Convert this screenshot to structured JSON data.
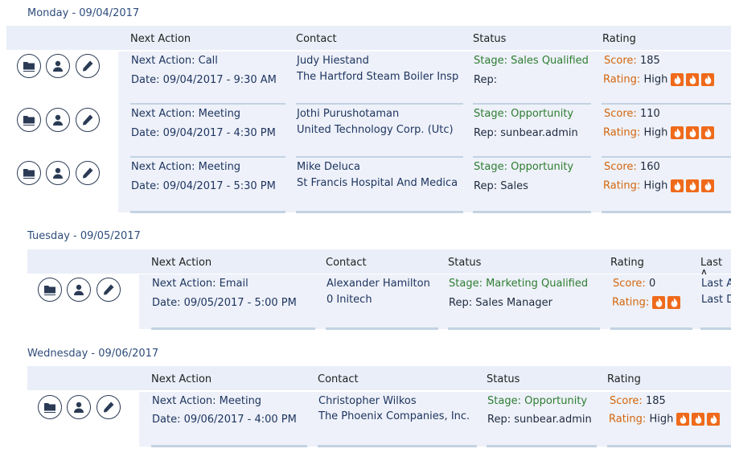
{
  "headers": {
    "next_action": "Next Action",
    "contact": "Contact",
    "status": "Status",
    "rating": "Rating",
    "last": "Last A"
  },
  "days": [
    {
      "title": "Monday - 09/04/2017",
      "rows": [
        {
          "next_action": "Next Action: Call",
          "date": "Date: 09/04/2017 - 9:30 AM",
          "contact_name": "Judy Hiestand",
          "company": "The Hartford Steam Boiler Insp",
          "stage_label": "Stage:",
          "stage": "Sales Qualified",
          "rep_label": "Rep:",
          "rep": "",
          "score_label": "Score:",
          "score": "185",
          "rating_label": "Rating:",
          "rating": "High",
          "flames": 3
        },
        {
          "next_action": "Next Action: Meeting",
          "date": "Date: 09/04/2017 - 4:30 PM",
          "contact_name": "Jothi Purushotaman",
          "company": "United Technology Corp. (Utc)",
          "stage_label": "Stage:",
          "stage": "Opportunity",
          "rep_label": "Rep:",
          "rep": "sunbear.admin",
          "score_label": "Score:",
          "score": "110",
          "rating_label": "Rating:",
          "rating": "High",
          "flames": 3
        },
        {
          "next_action": "Next Action: Meeting",
          "date": "Date: 09/04/2017 - 5:30 PM",
          "contact_name": "Mike Deluca",
          "company": "St Francis Hospital And Medica",
          "stage_label": "Stage:",
          "stage": "Opportunity",
          "rep_label": "Rep:",
          "rep": "Sales",
          "score_label": "Score:",
          "score": "160",
          "rating_label": "Rating:",
          "rating": "High",
          "flames": 3
        }
      ]
    },
    {
      "title": "Tuesday - 09/05/2017",
      "rows": [
        {
          "next_action": "Next Action: Email",
          "date": "Date: 09/05/2017 - 5:00 PM",
          "contact_name": "Alexander Hamilton",
          "company": "0 Initech",
          "stage_label": "Stage:",
          "stage": "Marketing Qualified",
          "rep_label": "Rep:",
          "rep": "Sales Manager",
          "score_label": "Score:",
          "score": "0",
          "rating_label": "Rating:",
          "rating": "",
          "flames": 2,
          "last1": "Last A",
          "last2": "Last D"
        }
      ]
    },
    {
      "title": "Wednesday - 09/06/2017",
      "rows": [
        {
          "next_action": "Next Action: Meeting",
          "date": "Date: 09/06/2017 - 4:00 PM",
          "contact_name": "Christopher Wilkos",
          "company": "The Phoenix Companies, Inc.",
          "stage_label": "Stage:",
          "stage": "Opportunity",
          "rep_label": "Rep:",
          "rep": "sunbear.admin",
          "score_label": "Score:",
          "score": "185",
          "rating_label": "Rating:",
          "rating": "High",
          "flames": 3
        }
      ]
    }
  ],
  "icons": {
    "folder": "folder-icon",
    "contact": "user-icon",
    "edit": "pencil-icon",
    "rating": "flame-icon"
  }
}
